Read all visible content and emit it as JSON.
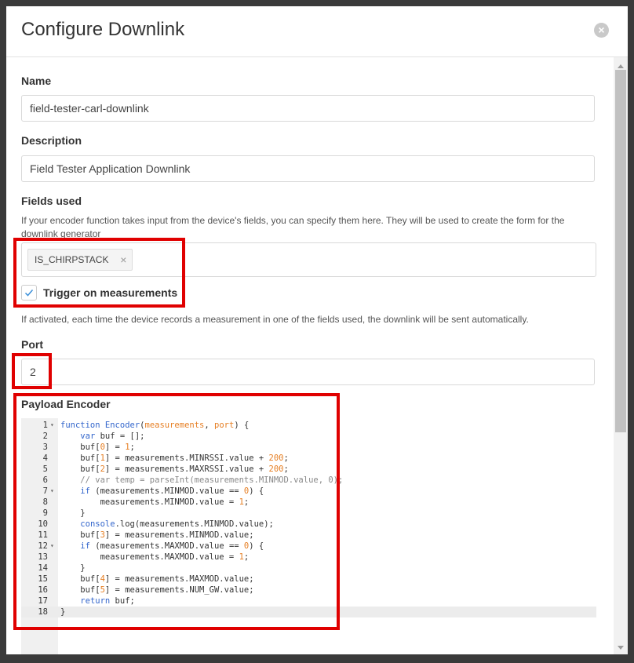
{
  "modal": {
    "title": "Configure Downlink",
    "close_glyph": "×"
  },
  "form": {
    "name_label": "Name",
    "name_value": "field-tester-carl-downlink",
    "description_label": "Description",
    "description_value": "Field Tester Application Downlink",
    "fields_label": "Fields used",
    "fields_help": "If your encoder function takes input from the device's fields, you can specify them here. They will be used to create the form for the downlink generator",
    "fields_tags": [
      {
        "label": "IS_CHIRPSTACK",
        "remove_glyph": "×"
      }
    ],
    "trigger_label": "Trigger on measurements",
    "trigger_checked": true,
    "trigger_help": "If activated, each time the device records a measurement in one of the fields used, the downlink will be sent automatically.",
    "port_label": "Port",
    "port_value": "2",
    "encoder_label": "Payload Encoder"
  },
  "editor": {
    "line_numbers": [
      "1",
      "2",
      "3",
      "4",
      "5",
      "6",
      "7",
      "8",
      "9",
      "10",
      "11",
      "12",
      "13",
      "14",
      "15",
      "16",
      "17",
      "18"
    ],
    "fold_lines": [
      1,
      7,
      12
    ],
    "active_line": 18,
    "lines": [
      "function Encoder(measurements, port) {",
      "    var buf = [];",
      "    buf[0] = 1;",
      "    buf[1] = measurements.MINRSSI.value + 200;",
      "    buf[2] = measurements.MAXRSSI.value + 200;",
      "    // var temp = parseInt(measurements.MINMOD.value, 0);",
      "    if (measurements.MINMOD.value == 0) {",
      "        measurements.MINMOD.value = 1;",
      "    }",
      "    console.log(measurements.MINMOD.value);",
      "    buf[3] = measurements.MINMOD.value;",
      "    if (measurements.MAXMOD.value == 0) {",
      "        measurements.MAXMOD.value = 1;",
      "    }",
      "    buf[4] = measurements.MAXMOD.value;",
      "    buf[5] = measurements.NUM_GW.value;",
      "    return buf;",
      "}"
    ]
  },
  "icons": {
    "close": "close-icon",
    "remove_tag": "close-icon",
    "check": "checkmark-icon"
  },
  "colors": {
    "highlight": "#e00000",
    "keyword": "#3366cc",
    "number": "#e67e22",
    "comment": "#888888",
    "check": "#3b8fd9"
  }
}
